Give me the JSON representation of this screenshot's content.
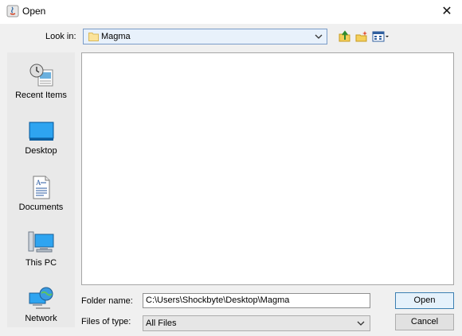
{
  "window": {
    "title": "Open"
  },
  "look_in": {
    "label": "Look in:",
    "value": "Magma"
  },
  "shortcuts": [
    {
      "label": "Recent Items",
      "icon": "recent-items-icon"
    },
    {
      "label": "Desktop",
      "icon": "desktop-icon"
    },
    {
      "label": "Documents",
      "icon": "documents-icon"
    },
    {
      "label": "This PC",
      "icon": "this-pc-icon"
    },
    {
      "label": "Network",
      "icon": "network-icon"
    }
  ],
  "folder_name": {
    "label": "Folder name:",
    "value": "C:\\Users\\Shockbyte\\Desktop\\Magma"
  },
  "files_of_type": {
    "label": "Files of type:",
    "value": "All Files"
  },
  "buttons": {
    "open": "Open",
    "cancel": "Cancel"
  },
  "colors": {
    "accent": "#3c7fb1",
    "combo_bg": "#e8f1fb"
  }
}
